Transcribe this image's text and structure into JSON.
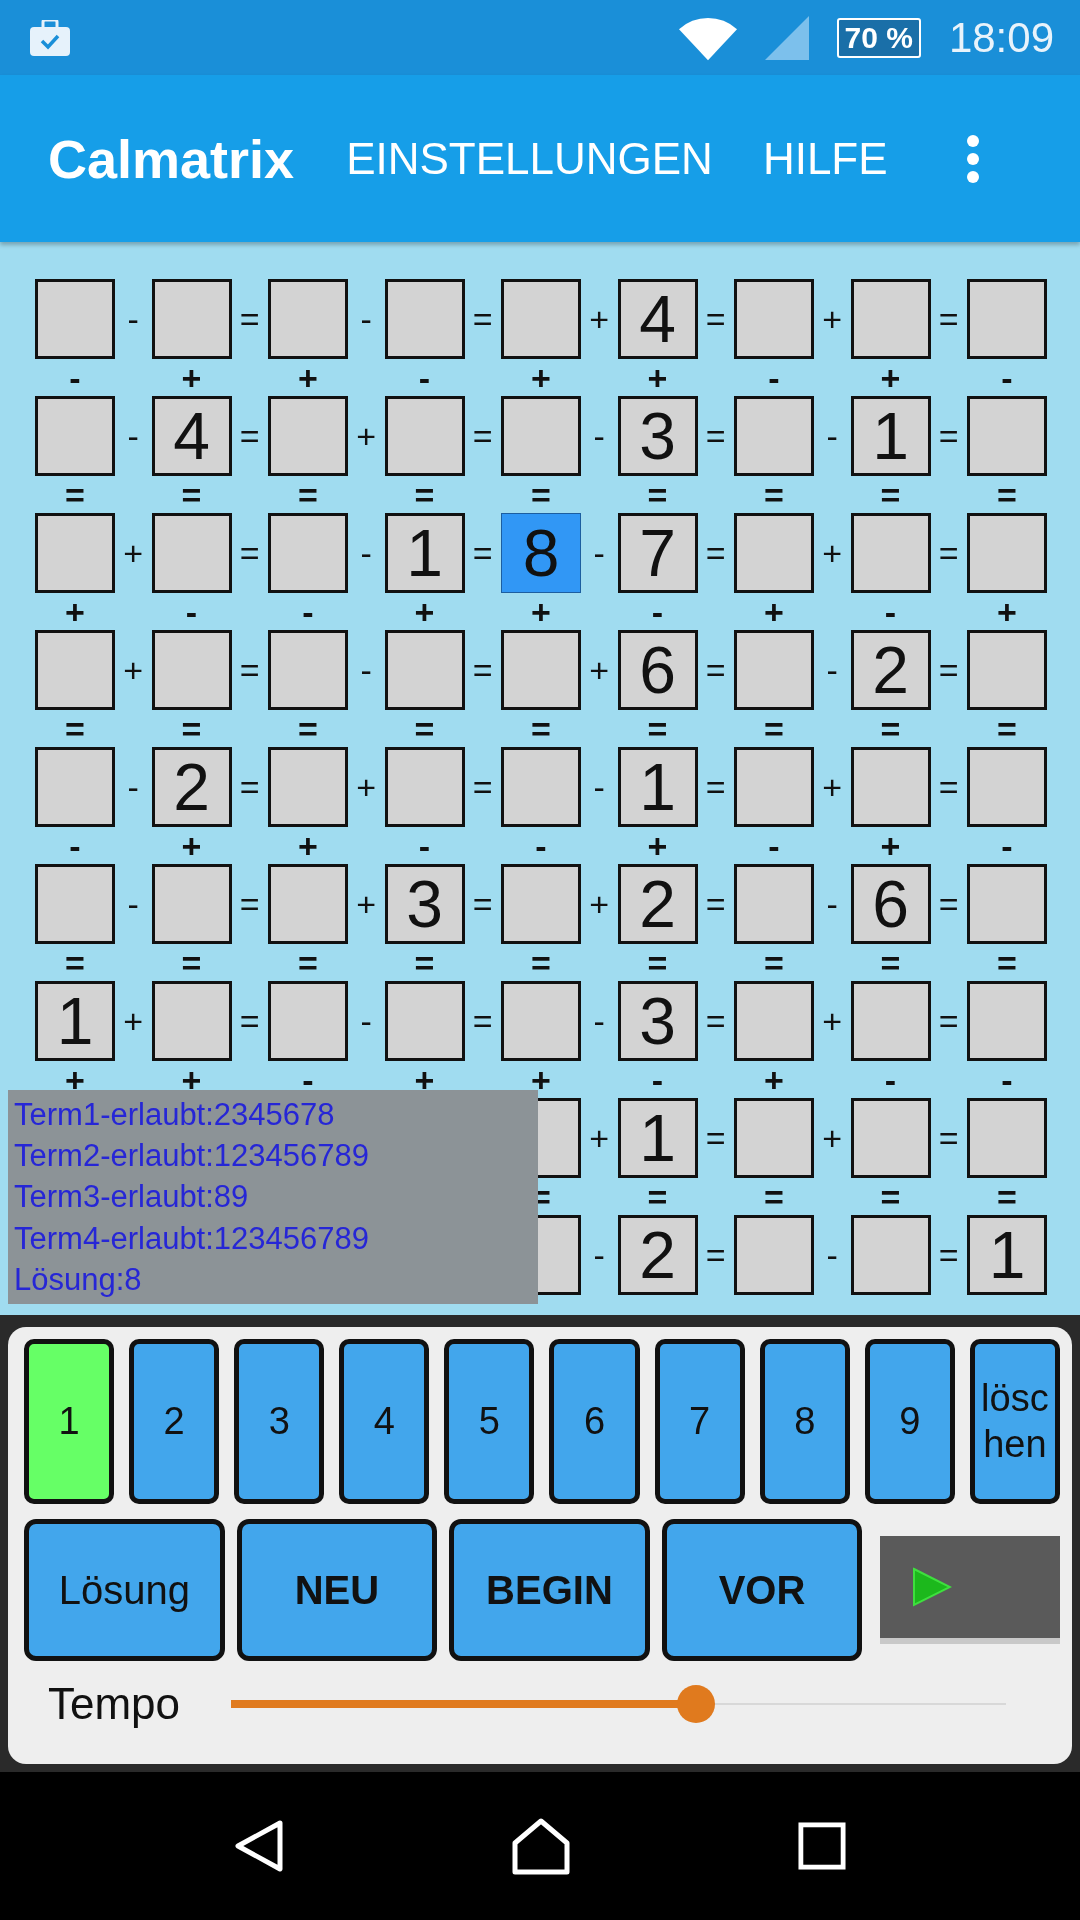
{
  "status_bar": {
    "battery": "70 %",
    "time": "18:09"
  },
  "app_bar": {
    "title": "Calmatrix",
    "actions": [
      "EINSTELLUNGEN",
      "HILFE"
    ]
  },
  "grid": {
    "rows": [
      {
        "cells": [
          {
            "selected": false
          },
          {
            "selected": false
          },
          {
            "selected": false
          },
          {
            "selected": false
          },
          {
            "selected": false
          },
          {
            "value": "4",
            "selected": false
          },
          {
            "selected": false
          },
          {
            "selected": false
          },
          {
            "selected": false
          }
        ],
        "operators": [
          "-",
          "=",
          "-",
          "=",
          "+",
          "=",
          "+",
          "="
        ],
        "operators_below": [
          "-",
          "+",
          "+",
          "-",
          "+",
          "+",
          "-",
          "+",
          "-"
        ]
      },
      {
        "cells": [
          {
            "selected": false
          },
          {
            "value": "4",
            "selected": false
          },
          {
            "selected": false
          },
          {
            "selected": false
          },
          {
            "selected": false
          },
          {
            "value": "3",
            "selected": false
          },
          {
            "selected": false
          },
          {
            "value": "1",
            "selected": false
          },
          {
            "selected": false
          }
        ],
        "operators": [
          "-",
          "=",
          "+",
          "=",
          "-",
          "=",
          "-",
          "="
        ],
        "operators_below": [
          "=",
          "=",
          "=",
          "=",
          "=",
          "=",
          "=",
          "=",
          "="
        ]
      },
      {
        "cells": [
          {
            "selected": false
          },
          {
            "selected": false
          },
          {
            "selected": false
          },
          {
            "value": "1",
            "selected": false
          },
          {
            "value": "8",
            "selected": true
          },
          {
            "value": "7",
            "selected": false
          },
          {
            "selected": false
          },
          {
            "selected": false
          },
          {
            "selected": false
          }
        ],
        "operators": [
          "+",
          "=",
          "-",
          "=",
          "-",
          "=",
          "+",
          "="
        ],
        "operators_below": [
          "+",
          "-",
          "-",
          "+",
          "+",
          "-",
          "+",
          "-",
          "+"
        ]
      },
      {
        "cells": [
          {
            "selected": false
          },
          {
            "selected": false
          },
          {
            "selected": false
          },
          {
            "selected": false
          },
          {
            "selected": false
          },
          {
            "value": "6",
            "selected": false
          },
          {
            "selected": false
          },
          {
            "value": "2",
            "selected": false
          },
          {
            "selected": false
          }
        ],
        "operators": [
          "+",
          "=",
          "-",
          "=",
          "+",
          "=",
          "-",
          "="
        ],
        "operators_below": [
          "=",
          "=",
          "=",
          "=",
          "=",
          "=",
          "=",
          "=",
          "="
        ]
      },
      {
        "cells": [
          {
            "selected": false
          },
          {
            "value": "2",
            "selected": false
          },
          {
            "selected": false
          },
          {
            "selected": false
          },
          {
            "selected": false
          },
          {
            "value": "1",
            "selected": false
          },
          {
            "selected": false
          },
          {
            "selected": false
          },
          {
            "selected": false
          }
        ],
        "operators": [
          "-",
          "=",
          "+",
          "=",
          "-",
          "=",
          "+",
          "="
        ],
        "operators_below": [
          "-",
          "+",
          "+",
          "-",
          "-",
          "+",
          "-",
          "+",
          "-"
        ]
      },
      {
        "cells": [
          {
            "selected": false
          },
          {
            "selected": false
          },
          {
            "selected": false
          },
          {
            "value": "3",
            "selected": false
          },
          {
            "selected": false
          },
          {
            "value": "2",
            "selected": false
          },
          {
            "selected": false
          },
          {
            "value": "6",
            "selected": false
          },
          {
            "selected": false
          }
        ],
        "operators": [
          "-",
          "=",
          "+",
          "=",
          "+",
          "=",
          "-",
          "="
        ],
        "operators_below": [
          "=",
          "=",
          "=",
          "=",
          "=",
          "=",
          "=",
          "=",
          "="
        ]
      },
      {
        "cells": [
          {
            "value": "1",
            "selected": false
          },
          {
            "selected": false
          },
          {
            "selected": false
          },
          {
            "selected": false
          },
          {
            "selected": false
          },
          {
            "value": "3",
            "selected": false
          },
          {
            "selected": false
          },
          {
            "selected": false
          },
          {
            "selected": false
          }
        ],
        "operators": [
          "+",
          "=",
          "-",
          "=",
          "-",
          "=",
          "+",
          "="
        ],
        "operators_below": [
          "+",
          "+",
          "-",
          "+",
          "+",
          "-",
          "+",
          "-",
          "-"
        ]
      },
      {
        "cells": [
          {
            "selected": false
          },
          {
            "value": "1",
            "selected": false
          },
          {
            "selected": false
          },
          {
            "selected": false
          },
          {
            "selected": false
          }
        ],
        "operators": [
          "+",
          "=",
          "+",
          "="
        ],
        "operators_below": [
          "=",
          "=",
          "=",
          "=",
          "="
        ]
      },
      {
        "cells": [
          {
            "selected": false
          },
          {
            "value": "2",
            "selected": false
          },
          {
            "selected": false
          },
          {
            "selected": false
          },
          {
            "value": "1",
            "selected": false
          }
        ],
        "operators": [
          "-",
          "=",
          "-",
          "="
        ]
      }
    ]
  },
  "hints": [
    "Term1-erlaubt:2345678",
    "Term2-erlaubt:123456789",
    "Term3-erlaubt:89",
    "Term4-erlaubt:123456789",
    "Lösung:8"
  ],
  "keypad": [
    {
      "label": "1",
      "selected": true
    },
    {
      "label": "2",
      "selected": false
    },
    {
      "label": "3",
      "selected": false
    },
    {
      "label": "4",
      "selected": false
    },
    {
      "label": "5",
      "selected": false
    },
    {
      "label": "6",
      "selected": false
    },
    {
      "label": "7",
      "selected": false
    },
    {
      "label": "8",
      "selected": false
    },
    {
      "label": "9",
      "selected": false
    },
    {
      "label": "löschen",
      "selected": false
    }
  ],
  "actions": [
    {
      "label": "Lösung",
      "bold": false
    },
    {
      "label": "NEU",
      "bold": true
    },
    {
      "label": "BEGIN",
      "bold": true
    },
    {
      "label": "VOR",
      "bold": true
    }
  ],
  "tempo": {
    "label": "Tempo",
    "level": 0.6
  }
}
